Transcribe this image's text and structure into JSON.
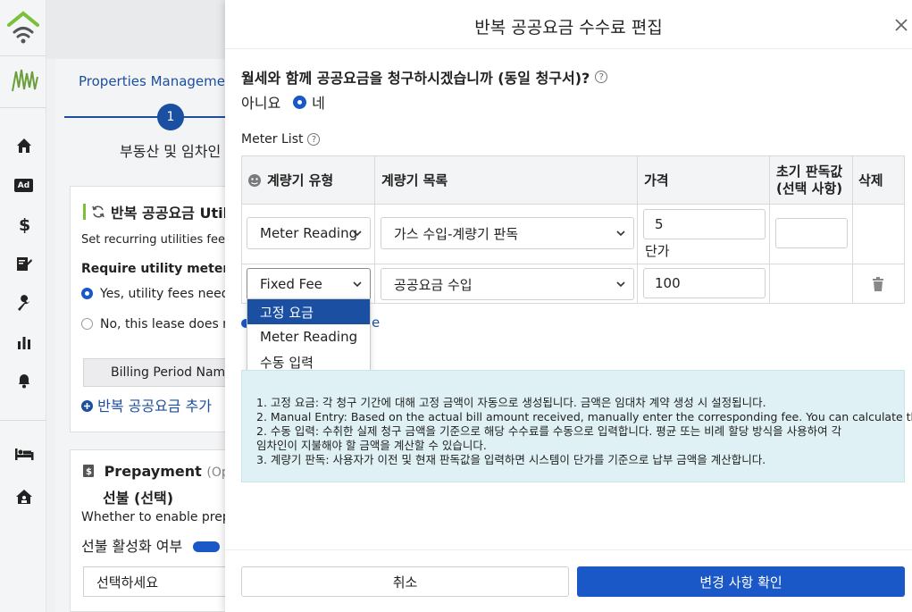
{
  "modal": {
    "title": "반복 공공요금 수수료 편집",
    "close_label": "×",
    "question": "월세와 함께 공공요금을 청구하시겠습니까 (동일 청구서)?",
    "option_no": "아니요",
    "option_yes": "네",
    "meter_list_label": "Meter List",
    "table": {
      "headers": {
        "meter_type": "계량기 유형",
        "meter_list": "계량기 목록",
        "price": "가격",
        "initial_reading_line1": "초기 판독값",
        "initial_reading_line2": "(선택 사항)",
        "delete": "삭제"
      },
      "rows": [
        {
          "type": "Meter Reading",
          "item": "가스 수입-계량기 판독",
          "price": "5",
          "unit": "단가",
          "initial": ""
        },
        {
          "type": "Fixed Fee",
          "item": "공공요금 수입",
          "price": "100"
        }
      ]
    },
    "dropdown_options": [
      "고정 요금",
      "Meter Reading",
      "수동 입력"
    ],
    "hidden_text_fragment": "e",
    "info_lines": [
      "1. 고정 요금: 각 청구 기간에 대해 고정 금액이 자동으로 생성됩니다. 금액은 임대차 계약 생성 시 설정됩니다.",
      "2. Manual Entry: Based on the actual bill amount received, manually enter the corresponding fee. You can calculate the.",
      "2. 수동 입력: 수취한 실제 청구 금액을 기준으로 해당 수수료를 수동으로 입력합니다. 평균 또는 비례 할당 방식을 사용하여 각",
      "임차인이 지불해야 할 금액을 계산할 수 있습니다.",
      "3. 계량기 판독: 사용자가 이전 및 현재 판독값을 입력하면 시스템이 단가를 기준으로 납부 금액을 계산합니다."
    ],
    "cancel_label": "취소",
    "confirm_label": "변경 사항 확인"
  },
  "background": {
    "step_tab": "Properties Management I",
    "step_number": "1",
    "step_label": "부동산 및 임차인",
    "card1": {
      "title": "반복 공공요금 Utili",
      "desc": "Set recurring utilities fee ite",
      "question": "Require utility metering?",
      "opt_yes": "Yes, utility fees need te",
      "opt_no": "No, this lease does nou",
      "billing_btn": "Billing Period Namea",
      "add_link": "반복 공공요금 추가"
    },
    "card2": {
      "title": "Prepayment",
      "title_suffix": "(Options",
      "subtitle": "선불 (선택)",
      "desc": "Whether to enable prepa",
      "toggle_label": "선불 활성화 여부",
      "select_placeholder": "선택하세요"
    }
  },
  "colors": {
    "primary": "#1a57c7",
    "info_bg": "#dff1f4",
    "accent_green": "#7bbf3a"
  }
}
